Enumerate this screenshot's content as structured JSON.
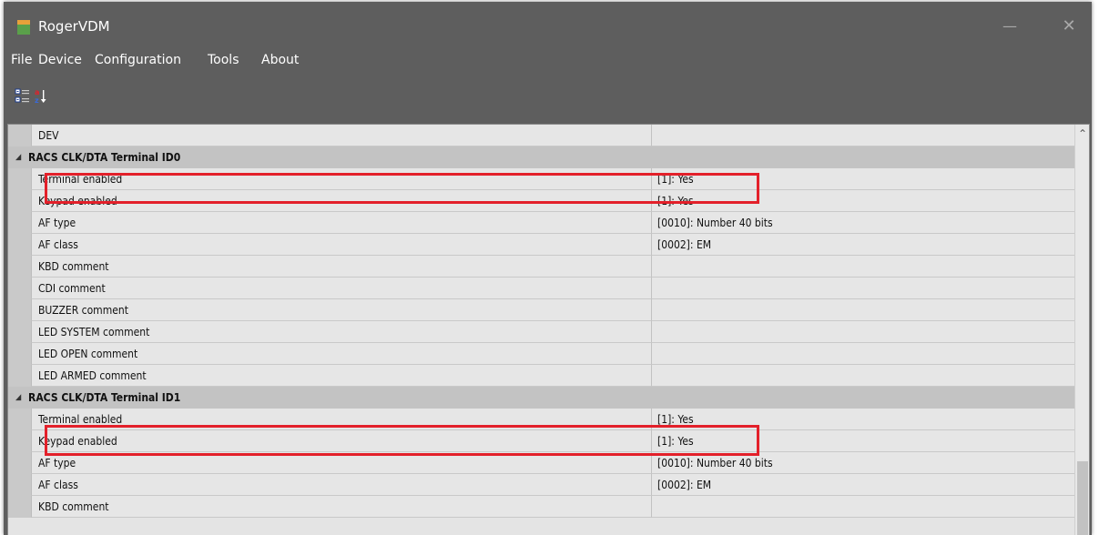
{
  "app": {
    "title": "RogerVDM"
  },
  "window_controls": {
    "minimize": "—",
    "close": "✕"
  },
  "menu": [
    "File",
    "Device",
    "Configuration",
    "Tools",
    "About"
  ],
  "toolbar": {
    "categorized": "categorized-view-icon",
    "alphabetical": "alphabetical-sort-icon"
  },
  "properties": {
    "top_row": {
      "name": "DEV",
      "value": ""
    },
    "sections": [
      {
        "title": "RACS CLK/DTA Terminal ID0",
        "rows": [
          {
            "name": "Terminal enabled",
            "value": "[1]: Yes"
          },
          {
            "name": "Keypad enabled",
            "value": "[1]: Yes"
          },
          {
            "name": "AF type",
            "value": "[0010]: Number 40 bits"
          },
          {
            "name": "AF class",
            "value": "[0002]: EM"
          },
          {
            "name": "KBD comment",
            "value": ""
          },
          {
            "name": "CDI comment",
            "value": ""
          },
          {
            "name": "BUZZER comment",
            "value": ""
          },
          {
            "name": "LED SYSTEM comment",
            "value": ""
          },
          {
            "name": "LED OPEN comment",
            "value": ""
          },
          {
            "name": "LED ARMED comment",
            "value": ""
          }
        ]
      },
      {
        "title": "RACS CLK/DTA Terminal ID1",
        "rows": [
          {
            "name": "Terminal enabled",
            "value": "[1]: Yes"
          },
          {
            "name": "Keypad enabled",
            "value": "[1]: Yes"
          },
          {
            "name": "AF type",
            "value": "[0010]: Number 40 bits"
          },
          {
            "name": "AF class",
            "value": "[0002]: EM"
          },
          {
            "name": "KBD comment",
            "value": ""
          }
        ]
      }
    ]
  },
  "colors": {
    "highlight": "#e3202a",
    "window": "#5e5e5e",
    "category": "#c3c3c3",
    "row": "#e6e6e6"
  }
}
